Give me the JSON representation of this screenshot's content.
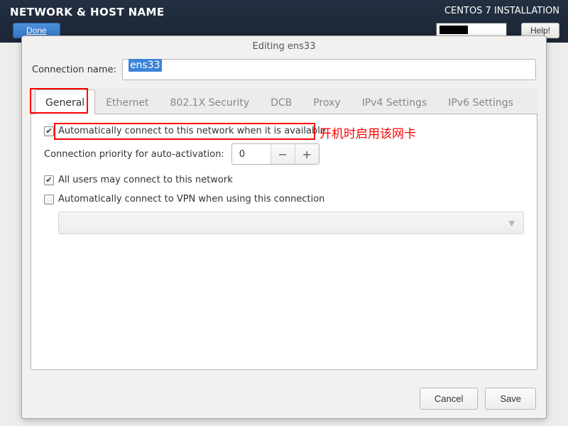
{
  "topbar": {
    "title": "NETWORK & HOST NAME",
    "installer": "CENTOS 7 INSTALLATION",
    "done": "Done",
    "help": "Help!"
  },
  "dialog": {
    "title": "Editing ens33",
    "conn_label": "Connection name:",
    "conn_value": "ens33",
    "tabs": {
      "general": "General",
      "ethernet": "Ethernet",
      "security": "802.1X Security",
      "dcb": "DCB",
      "proxy": "Proxy",
      "ipv4": "IPv4 Settings",
      "ipv6": "IPv6 Settings"
    },
    "general": {
      "auto_connect": "Automatically connect to this network when it is available",
      "priority_label": "Connection priority for auto-activation:",
      "priority_value": "0",
      "all_users": "All users may connect to this network",
      "auto_vpn": "Automatically connect to VPN when using this connection"
    },
    "buttons": {
      "cancel": "Cancel",
      "save": "Save"
    }
  },
  "annotation": {
    "text": "开机时启用该网卡"
  }
}
